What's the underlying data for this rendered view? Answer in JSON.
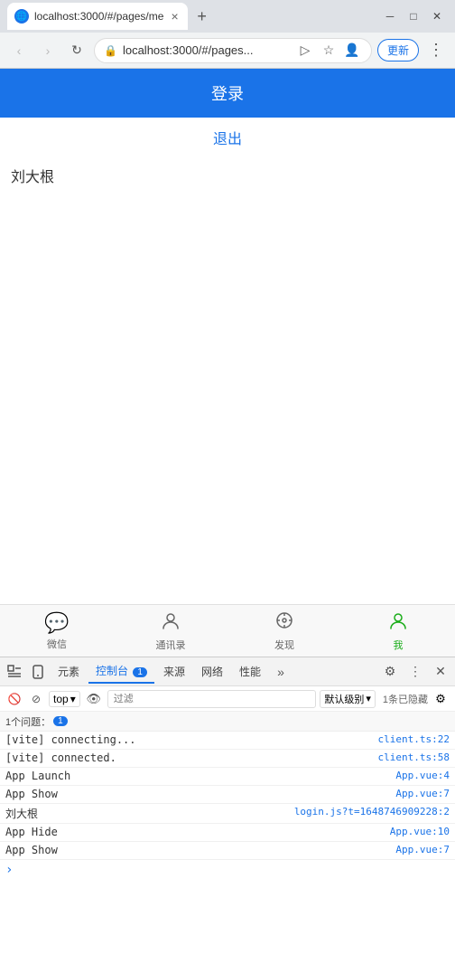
{
  "browser": {
    "tab_title": "localhost:3000/#/pages/me",
    "address": "localhost:3000/#/pages...",
    "update_btn": "更新",
    "nav": {
      "back_disabled": true,
      "forward_disabled": true
    }
  },
  "app": {
    "header_title": "登录",
    "logout_text": "退出",
    "user_name": "刘大根",
    "bottom_nav": [
      {
        "label": "微信",
        "icon": "💬",
        "active": false
      },
      {
        "label": "通讯录",
        "icon": "👤",
        "active": false
      },
      {
        "label": "发现",
        "icon": "🔍",
        "active": false
      },
      {
        "label": "我",
        "icon": "👤",
        "active": true
      }
    ]
  },
  "devtools": {
    "tabs": [
      {
        "label": "元素",
        "active": false
      },
      {
        "label": "控制台",
        "active": true
      },
      {
        "label": "来源",
        "active": false
      },
      {
        "label": "网络",
        "active": false
      },
      {
        "label": "性能",
        "active": false
      }
    ],
    "console_badge": "1",
    "context": "top",
    "filter_placeholder": "过滤",
    "level": "默认级别",
    "hidden_count": "1条已隐藏",
    "issues_count": "1个问题：",
    "issues_badge": "1",
    "log_entries": [
      {
        "text": "[vite] connecting...",
        "source": "client.ts:22"
      },
      {
        "text": "[vite] connected.",
        "source": "client.ts:58"
      },
      {
        "text": "App Launch",
        "source": "App.vue:4"
      },
      {
        "text": "App Show",
        "source": "App.vue:7"
      },
      {
        "text": "刘大根",
        "source": "login.js?t=1648746909228:2"
      },
      {
        "text": "App Hide",
        "source": "App.vue:10"
      },
      {
        "text": "App Show",
        "source": "App.vue:7"
      }
    ]
  }
}
